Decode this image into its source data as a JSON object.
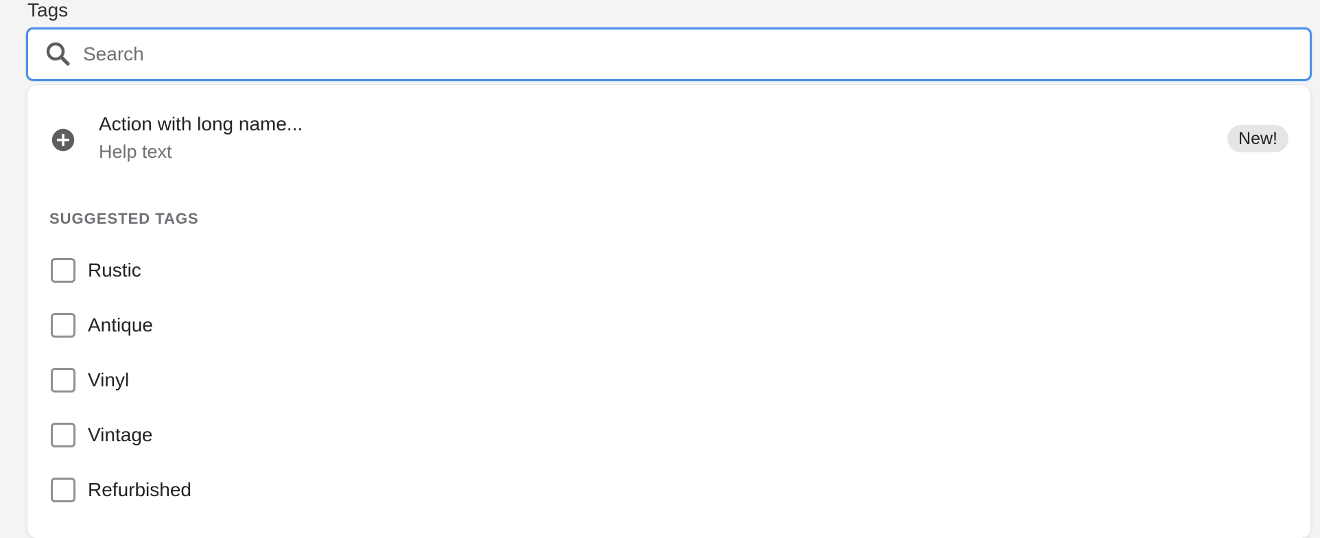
{
  "field": {
    "label": "Tags"
  },
  "search": {
    "placeholder": "Search",
    "value": ""
  },
  "action": {
    "title": "Action with long name...",
    "help": "Help text",
    "badge": "New!",
    "icon": "plus-circle-icon"
  },
  "suggested": {
    "title": "SUGGESTED TAGS",
    "items": [
      {
        "label": "Rustic",
        "checked": false
      },
      {
        "label": "Antique",
        "checked": false
      },
      {
        "label": "Vinyl",
        "checked": false
      },
      {
        "label": "Vintage",
        "checked": false
      },
      {
        "label": "Refurbished",
        "checked": false
      }
    ]
  },
  "colors": {
    "focus": "#4a8fe7",
    "text": "#202223",
    "subdued": "#6d7175",
    "badge_bg": "#e4e5e7"
  }
}
